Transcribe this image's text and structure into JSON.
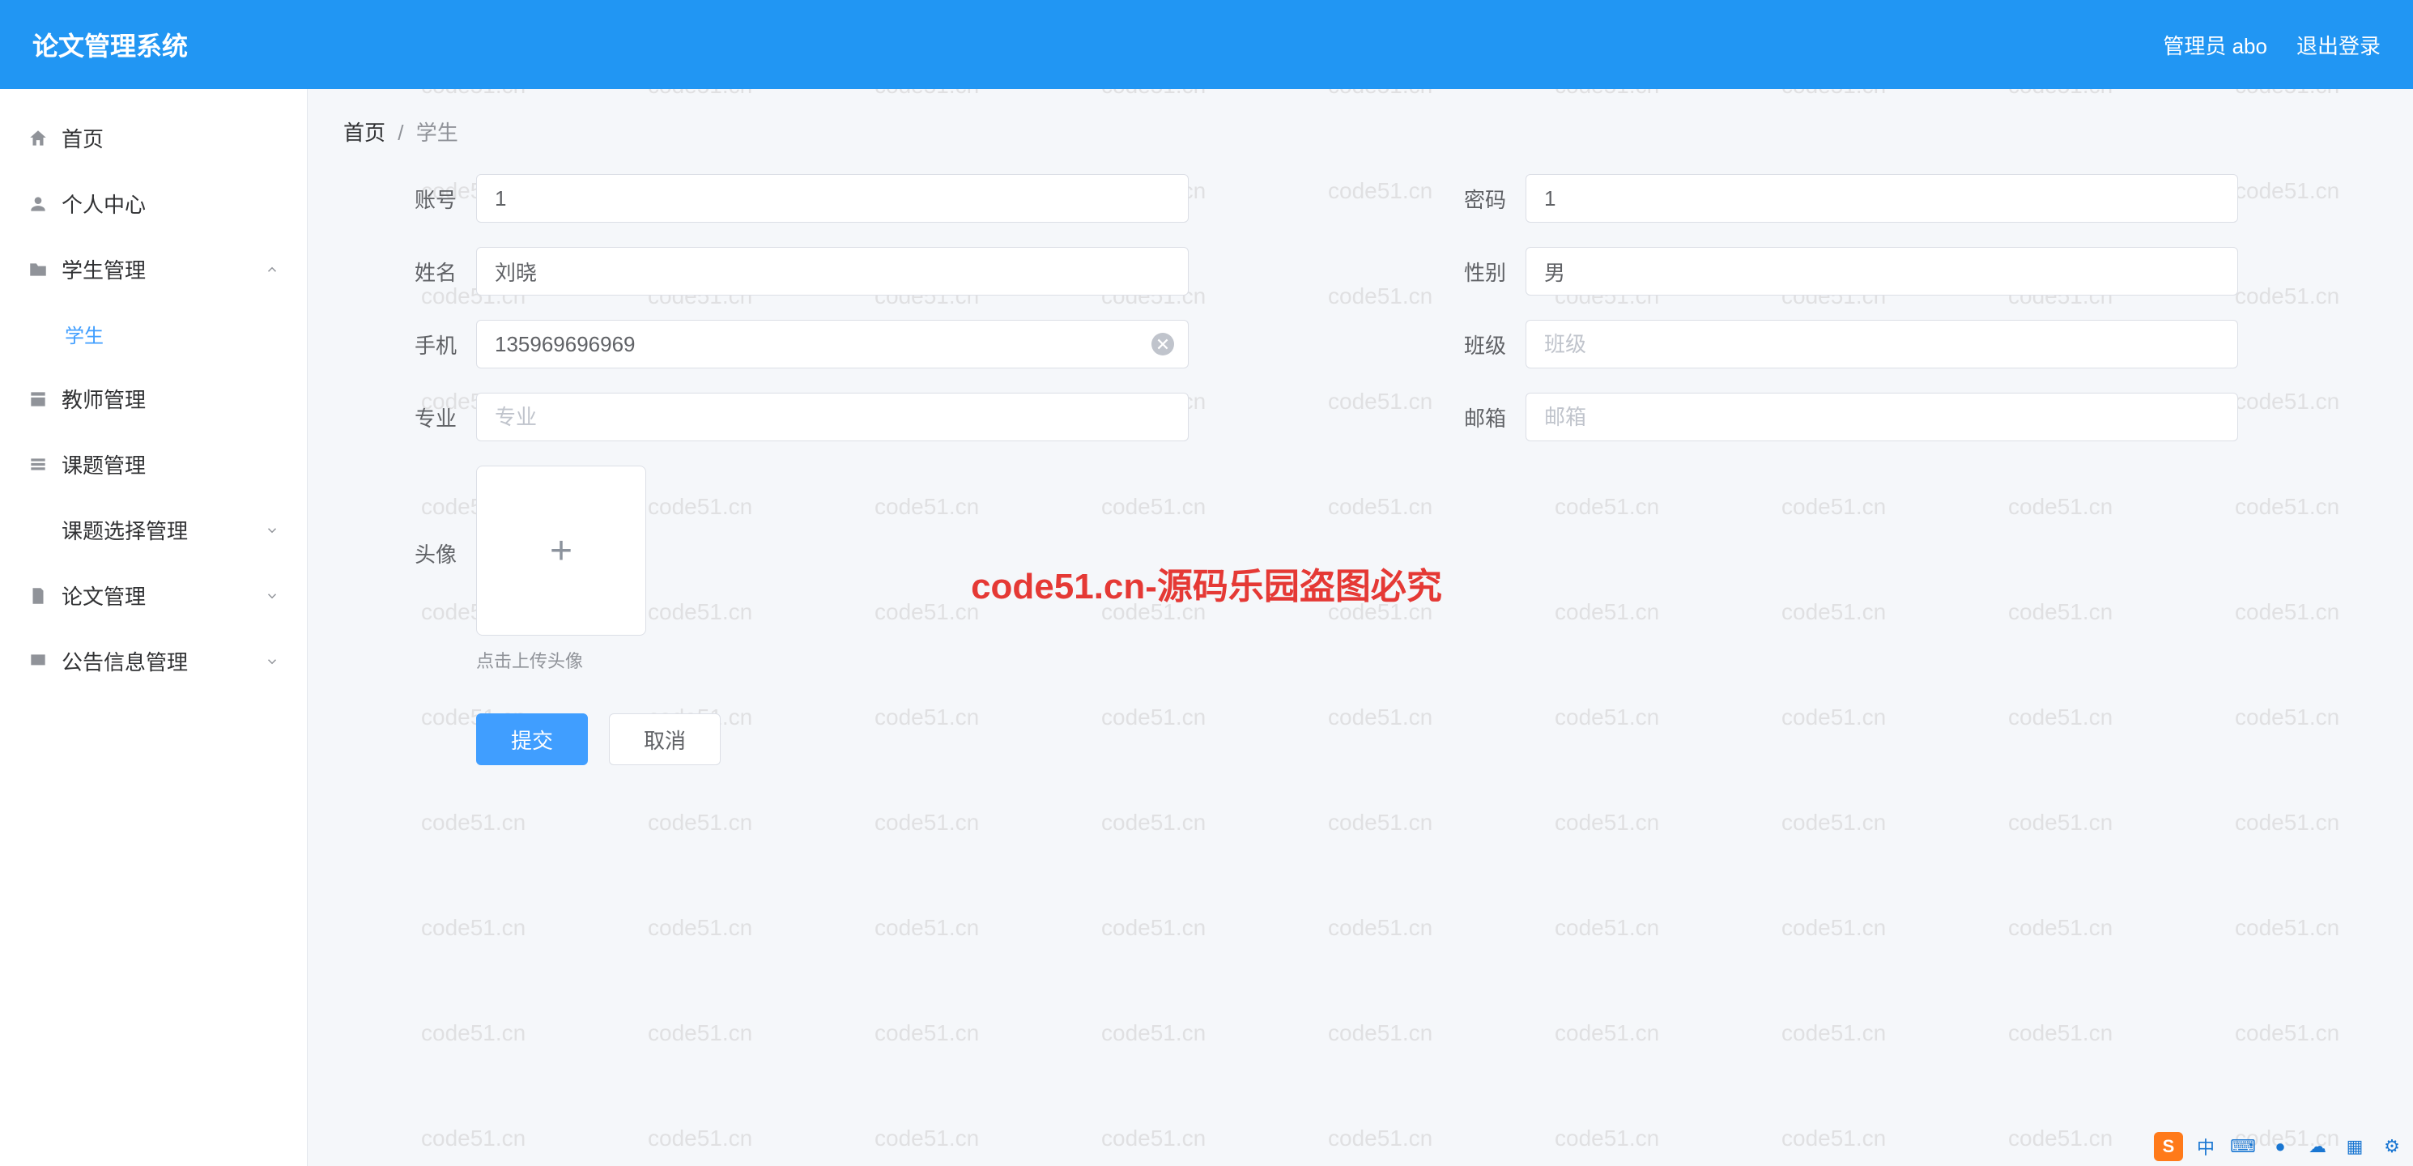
{
  "app": {
    "title": "论文管理系统"
  },
  "header": {
    "admin_label": "管理员 abo",
    "logout_label": "退出登录"
  },
  "watermark": {
    "text": "code51.cn",
    "center": "code51.cn-源码乐园盗图必究"
  },
  "sidebar": {
    "items": [
      {
        "icon": "home",
        "label": "首页",
        "expandable": false
      },
      {
        "icon": "person",
        "label": "个人中心",
        "expandable": false
      },
      {
        "icon": "folder",
        "label": "学生管理",
        "expandable": true,
        "expanded": true,
        "children": [
          {
            "label": "学生",
            "active": true
          }
        ]
      },
      {
        "icon": "teacher",
        "label": "教师管理",
        "expandable": false
      },
      {
        "icon": "topic",
        "label": "课题管理",
        "expandable": false
      },
      {
        "icon": "select",
        "label": "课题选择管理",
        "expandable": true,
        "expanded": false
      },
      {
        "icon": "paper",
        "label": "论文管理",
        "expandable": true,
        "expanded": false
      },
      {
        "icon": "notice",
        "label": "公告信息管理",
        "expandable": true,
        "expanded": false
      }
    ]
  },
  "breadcrumb": {
    "root": "首页",
    "separator": "/",
    "current": "学生"
  },
  "form": {
    "account": {
      "label": "账号",
      "value": "1"
    },
    "password": {
      "label": "密码",
      "value": "1"
    },
    "name": {
      "label": "姓名",
      "value": "刘晓"
    },
    "gender": {
      "label": "性别",
      "value": "男"
    },
    "phone": {
      "label": "手机",
      "value": "135969696969"
    },
    "class": {
      "label": "班级",
      "value": "",
      "placeholder": "班级"
    },
    "major": {
      "label": "专业",
      "value": "",
      "placeholder": "专业"
    },
    "email": {
      "label": "邮箱",
      "value": "",
      "placeholder": "邮箱"
    },
    "avatar": {
      "label": "头像",
      "hint": "点击上传头像"
    }
  },
  "actions": {
    "submit": "提交",
    "cancel": "取消"
  },
  "tray": {
    "ime": "中"
  }
}
